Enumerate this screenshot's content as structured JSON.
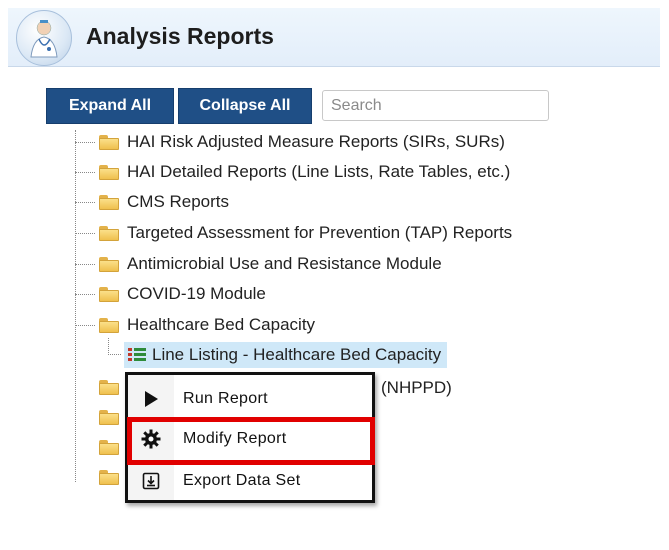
{
  "header": {
    "title": "Analysis Reports",
    "logo_icon": "doctor-logo-icon"
  },
  "toolbar": {
    "expand_label": "Expand All",
    "collapse_label": "Collapse All",
    "search_placeholder": "Search",
    "search_value": ""
  },
  "tree": {
    "folders": [
      "HAI Risk Adjusted Measure Reports (SIRs, SURs)",
      "HAI Detailed Reports (Line Lists, Rate Tables, etc.)",
      "CMS Reports",
      "Targeted Assessment for Prevention (TAP) Reports",
      "Antimicrobial Use and Resistance Module",
      "COVID-19 Module",
      "Healthcare Bed Capacity"
    ],
    "selected_report": "Line Listing - Healthcare Bed Capacity",
    "partially_hidden_label": "(NHPPD)"
  },
  "context_menu": {
    "items": [
      {
        "label": "Run Report",
        "icon": "play-icon"
      },
      {
        "label": "Modify Report",
        "icon": "gear-icon"
      },
      {
        "label": "Export Data Set",
        "icon": "export-icon"
      }
    ],
    "highlight_color": "#e10000"
  },
  "colors": {
    "button_bg": "#1f4f86",
    "selection_bg": "#cfe8f8",
    "folder": "#efc04e"
  }
}
